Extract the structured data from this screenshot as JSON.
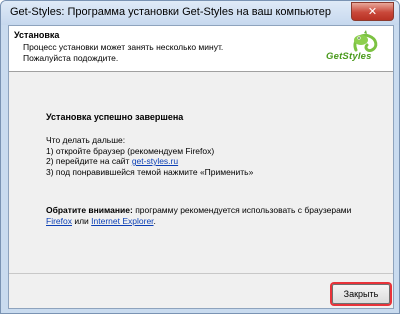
{
  "window": {
    "title": "Get-Styles:  Программа установки Get-Styles на ваш компьютер",
    "close_glyph": "✕"
  },
  "header": {
    "title": "Установка",
    "description_line1": "Процесс установки может занять несколько минут.",
    "description_line2": "Пожалуйста подождите.",
    "logo_text": "GetStyles"
  },
  "content": {
    "success_text": "Установка успешно завершена",
    "next_steps_label": "Что делать дальше:",
    "step1": "1) откройте браузер (рекомендуем Firefox)",
    "step2_prefix": "2) перейдите на сайт ",
    "step2_link": "get-styles.ru",
    "step3": "3) под понравившейся темой нажмите «Применить»",
    "notice_bold": "Обратите внимание:",
    "notice_text": " программу рекомендуется использовать с браузерами",
    "firefox_link": "Firefox",
    "or_text": " или ",
    "ie_link": "Internet Explorer",
    "period": "."
  },
  "footer": {
    "close_button_label": "Закрыть"
  },
  "colors": {
    "accent_link": "#0b3fb5",
    "highlight_box": "#e8333a",
    "logo_green": "#4a9a1c"
  }
}
